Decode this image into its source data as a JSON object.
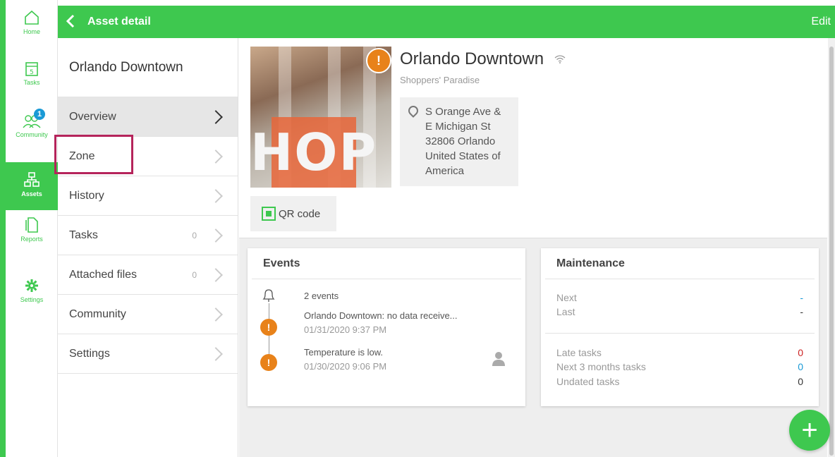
{
  "rail": {
    "items": [
      {
        "label": "Home",
        "icon": "home-icon"
      },
      {
        "label": "Tasks",
        "icon": "calendar-icon"
      },
      {
        "label": "Community",
        "icon": "community-icon",
        "badge": "1"
      },
      {
        "label": "Assets",
        "icon": "assets-icon",
        "active": true
      },
      {
        "label": "Reports",
        "icon": "reports-icon"
      },
      {
        "label": "Settings",
        "icon": "gear-icon"
      }
    ]
  },
  "topbar": {
    "title": "Asset detail",
    "edit_label": "Edit"
  },
  "nav": {
    "header": "Orlando Downtown",
    "items": [
      {
        "label": "Overview",
        "count": ""
      },
      {
        "label": "Zone",
        "count": ""
      },
      {
        "label": "History",
        "count": ""
      },
      {
        "label": "Tasks",
        "count": "0"
      },
      {
        "label": "Attached files",
        "count": "0"
      },
      {
        "label": "Community",
        "count": ""
      },
      {
        "label": "Settings",
        "count": ""
      }
    ]
  },
  "asset": {
    "name": "Orlando Downtown",
    "subtitle": "Shoppers' Paradise",
    "photo_text": "HOP",
    "warning_glyph": "!",
    "address": [
      "S Orange Ave &",
      "E Michigan St",
      "32806 Orlando",
      "United States of",
      "America"
    ],
    "qr_label": "QR code"
  },
  "events": {
    "title": "Events",
    "count_text": "2 events",
    "items": [
      {
        "text": "Orlando Downtown: no data receive...",
        "date": "01/31/2020 9:37 PM"
      },
      {
        "text": "Temperature is low.",
        "date": "01/30/2020 9:06 PM"
      }
    ]
  },
  "maintenance": {
    "title": "Maintenance",
    "next_label": "Next",
    "next_value": "-",
    "last_label": "Last",
    "last_value": "-",
    "late_label": "Late tasks",
    "late_value": "0",
    "next3_label": "Next 3 months tasks",
    "next3_value": "0",
    "undated_label": "Undated tasks",
    "undated_value": "0"
  },
  "fab": {
    "glyph": "+"
  },
  "colors": {
    "brand": "#3ec84f",
    "warning": "#e8821a",
    "late": "#cc2222",
    "info": "#1a9ad6",
    "highlight": "#b5245b"
  }
}
